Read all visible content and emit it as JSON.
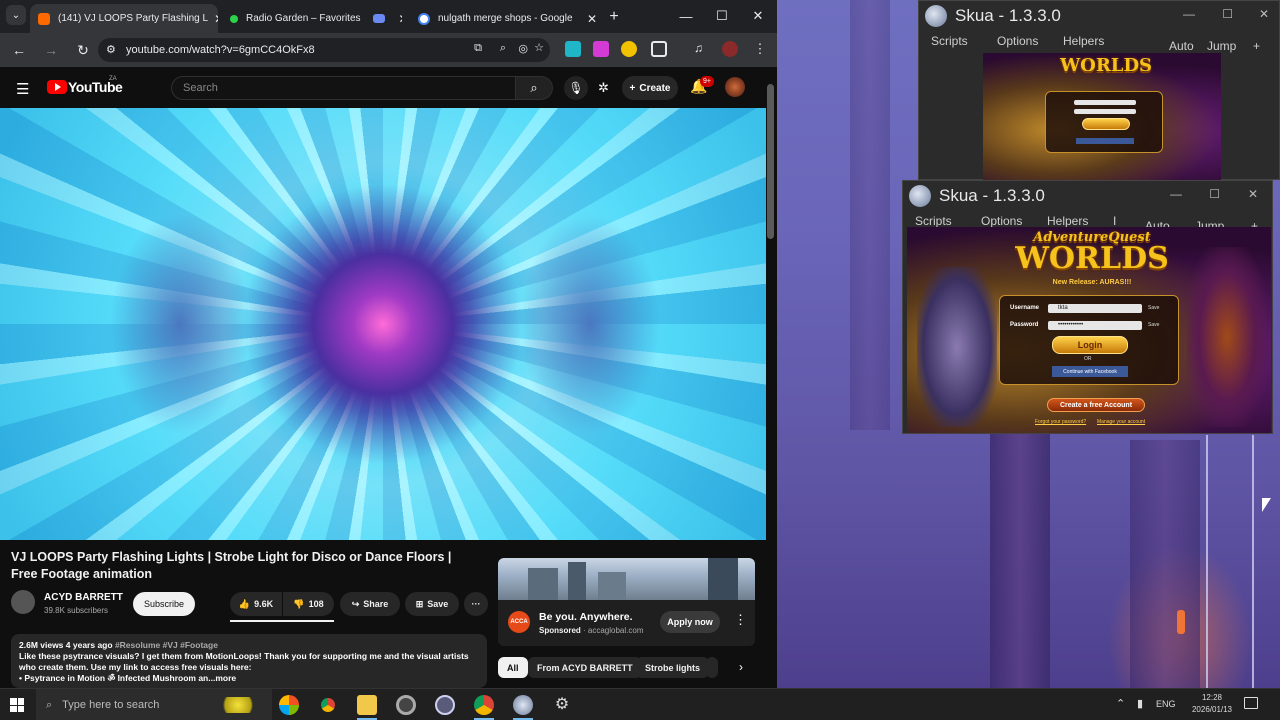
{
  "browser": {
    "tabs": [
      {
        "title": "(141) VJ LOOPS Party Flashing L",
        "active": true,
        "favicon_color": "#ff6a00"
      },
      {
        "title": "Radio Garden – Favorites",
        "active": false,
        "favicon_color": "#2bd34a"
      },
      {
        "title": "nulgath merge shops - Google",
        "active": false,
        "favicon_color": "#4285f4"
      }
    ],
    "url": "youtube.com/watch?v=6gmCC4OkFx8",
    "nav": {
      "back": "←",
      "forward": "→",
      "reload": "↻"
    }
  },
  "youtube": {
    "logo_text": "YouTube",
    "logo_region": "ZA",
    "search_placeholder": "Search",
    "create_label": "Create",
    "notif_count": "9+",
    "video_title": "VJ LOOPS Party Flashing Lights | Strobe Light for Disco or Dance Floors | Free Footage animation",
    "channel": {
      "name": "ACYD BARRETT",
      "subscribers": "39.8K subscribers"
    },
    "subscribe_label": "Subscribe",
    "likes": "9.6K",
    "dislikes": "108",
    "share_label": "Share",
    "save_label": "Save",
    "more_label": "···",
    "meta": "2.6M views  4 years ago",
    "hashtags": "#Resolume #VJ #Footage",
    "description": "Like these psytrance visuals? I get them from MotionLoops! Thank you for supporting me and the visual artists who create them. Use my link to access free visuals here:",
    "desc_item": "• Psytrance in Motion ॐ Infected Mushroom an",
    "desc_more": "...more",
    "ad": {
      "headline": "Be you. Anywhere.",
      "sponsored": "Sponsored",
      "domain": "accaglobal.com",
      "brand": "ACCA",
      "cta": "Apply now"
    },
    "chips": [
      "All",
      "From ACYD BARRETT",
      "Strobe lights"
    ]
  },
  "skua_windows": [
    {
      "title": "Skua - 1.3.3.0",
      "menu": [
        "Scripts",
        "Options",
        "Helpers",
        "Auto",
        "Jump",
        "+"
      ]
    },
    {
      "title": "Skua - 1.3.3.0",
      "menu": [
        "Scripts",
        "Options",
        "Helpers",
        "I",
        "Auto",
        "Jump",
        "+"
      ]
    }
  ],
  "game": {
    "logo_top": "AdventureQuest",
    "logo_main": "WORLDS",
    "release": "New Release: AURAS!!!",
    "username_label": "Username",
    "password_label": "Password",
    "save_label": "Save",
    "username_value": "tkta",
    "password_value": "••••••••••••",
    "login_label": "Login",
    "or_label": "OR",
    "facebook_label": "Continue with Facebook",
    "create_label": "Create a free Account",
    "forgot_label": "Forgot your password?",
    "manage_label": "Manage your account"
  },
  "taskbar": {
    "search_placeholder": "Type here to search",
    "lang": "ENG",
    "time": "12:28",
    "date": "2026/01/13"
  }
}
